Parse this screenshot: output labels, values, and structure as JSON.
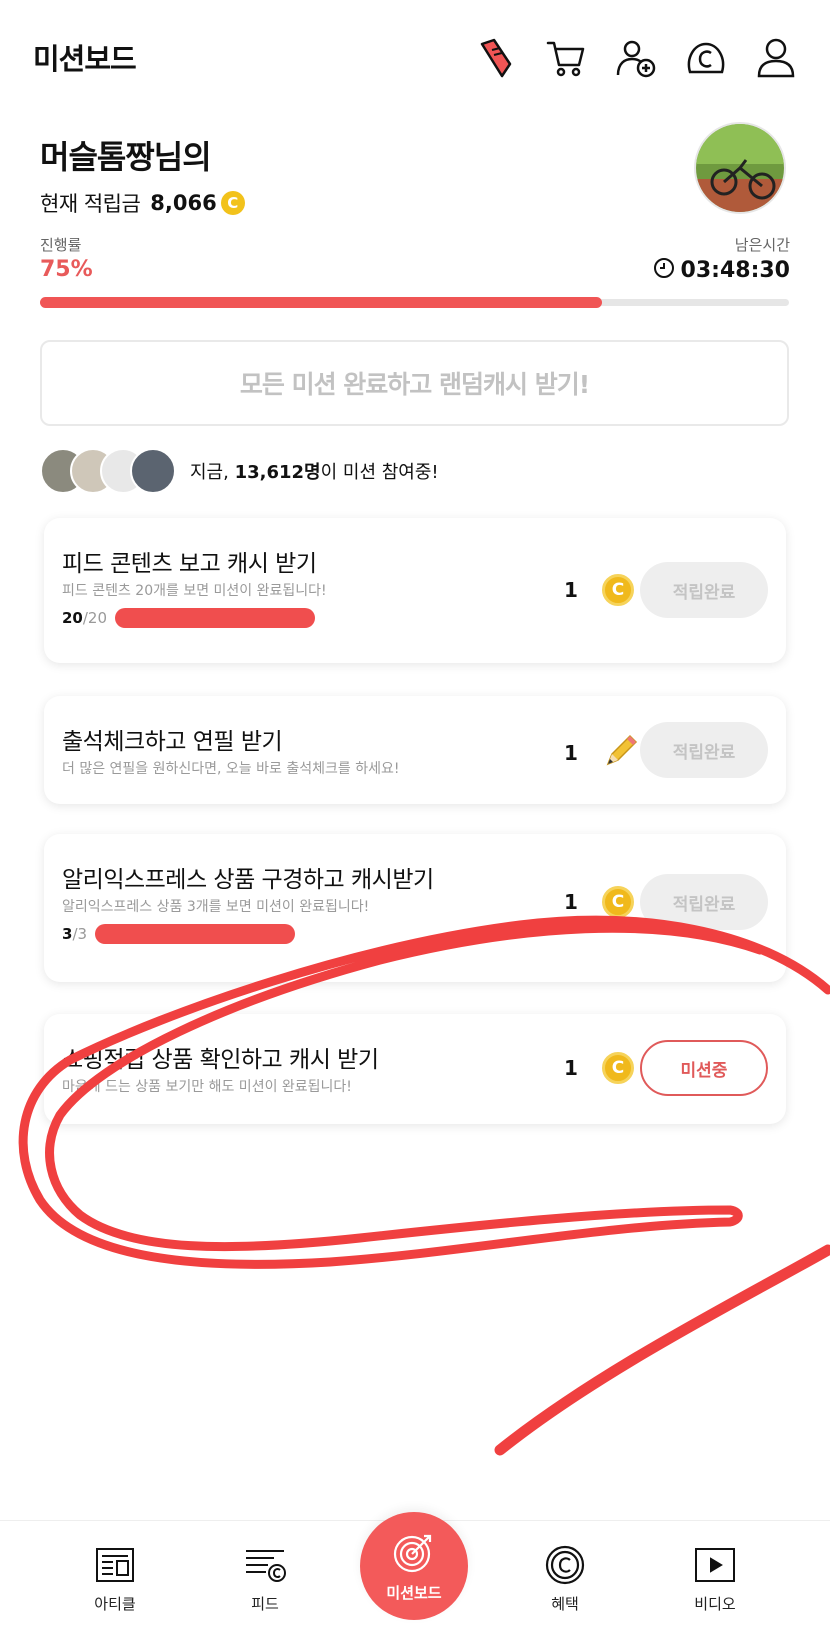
{
  "header": {
    "title": "미션보드",
    "icons": [
      "sneaker-icon",
      "cart-icon",
      "add-user-icon",
      "cash-icon",
      "profile-icon"
    ]
  },
  "profile": {
    "name": "머슬톰짱님의",
    "balance_label": "현재 적립금",
    "balance_value": "8,066",
    "coin_symbol": "C"
  },
  "progress": {
    "label": "진행률",
    "percent_text": "75%",
    "percent_value": 0.75,
    "remaining_label": "남은시간",
    "remaining_time": "03:48:30"
  },
  "all_mission_banner": "모든 미션 완료하고 랜덤캐시 받기!",
  "participants": {
    "prefix": "지금,",
    "count": "13,612명",
    "suffix": "이 미션 참여중!"
  },
  "missions": [
    {
      "title": "피드 콘텐츠 보고 캐시 받기",
      "desc": "피드 콘텐츠 20개를 보면 미션이 완료됩니다!",
      "progress_done": "20",
      "progress_total": "/20",
      "reward": "1",
      "reward_icon": "coin-icon",
      "button": "적립완료"
    },
    {
      "title": "출석체크하고 연필 받기",
      "desc": "더 많은 연필을 원하신다면, 오늘 바로 출석체크를 하세요!",
      "reward": "1",
      "reward_icon": "pencil-icon",
      "button": "적립완료"
    },
    {
      "title": "알리익스프레스 상품 구경하고 캐시받기",
      "desc": "알리익스프레스 상품 3개를 보면 미션이 완료됩니다!",
      "progress_done": "3",
      "progress_total": "/3",
      "reward": "1",
      "reward_icon": "coin-icon",
      "button": "적립완료"
    },
    {
      "title": "쇼핑적립 상품 확인하고 캐시 받기",
      "desc": "마음에 드는 상품 보기만 해도 미션이 완료됩니다!",
      "reward": "1",
      "reward_icon": "coin-icon",
      "button": "미션중"
    }
  ],
  "bottom_nav": {
    "article": "아티클",
    "feed": "피드",
    "missionboard": "미션보드",
    "benefit": "혜택",
    "video": "비디오"
  },
  "colors": {
    "accent": "#f05555",
    "coin": "#f0b91c",
    "annotation": "#f04040"
  }
}
